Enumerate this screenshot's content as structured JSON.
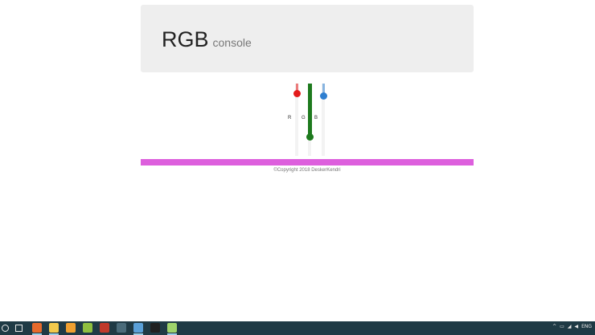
{
  "header": {
    "title": "RGB",
    "subtitle": "console"
  },
  "sliders": [
    {
      "label": "R",
      "value": 0.9,
      "color": "#e31b1b"
    },
    {
      "label": "G",
      "value": 0.0,
      "color": "#1e7a1e"
    },
    {
      "label": "B",
      "value": 0.85,
      "color": "#2f7fd0"
    }
  ],
  "footer": {
    "bar_color": "#dd5fdd",
    "copyright": "©Copyright 2018 DeskerKendri"
  },
  "taskbar": {
    "apps": [
      {
        "icon": "firefox-icon",
        "color": "#e66a2c"
      },
      {
        "icon": "file-explorer-icon",
        "color": "#f2c94c"
      },
      {
        "icon": "app-orange-icon",
        "color": "#f0a030"
      },
      {
        "icon": "app-triangle-icon",
        "color": "#8fbf3f"
      },
      {
        "icon": "app-red-icon",
        "color": "#c0392b"
      },
      {
        "icon": "app-person-icon",
        "color": "#4a6b7a"
      },
      {
        "icon": "app-window-icon",
        "color": "#5aa0d8"
      },
      {
        "icon": "terminal-icon",
        "color": "#202020"
      },
      {
        "icon": "notepad-icon",
        "color": "#9fd36b"
      }
    ],
    "tray_language": "ENG"
  }
}
